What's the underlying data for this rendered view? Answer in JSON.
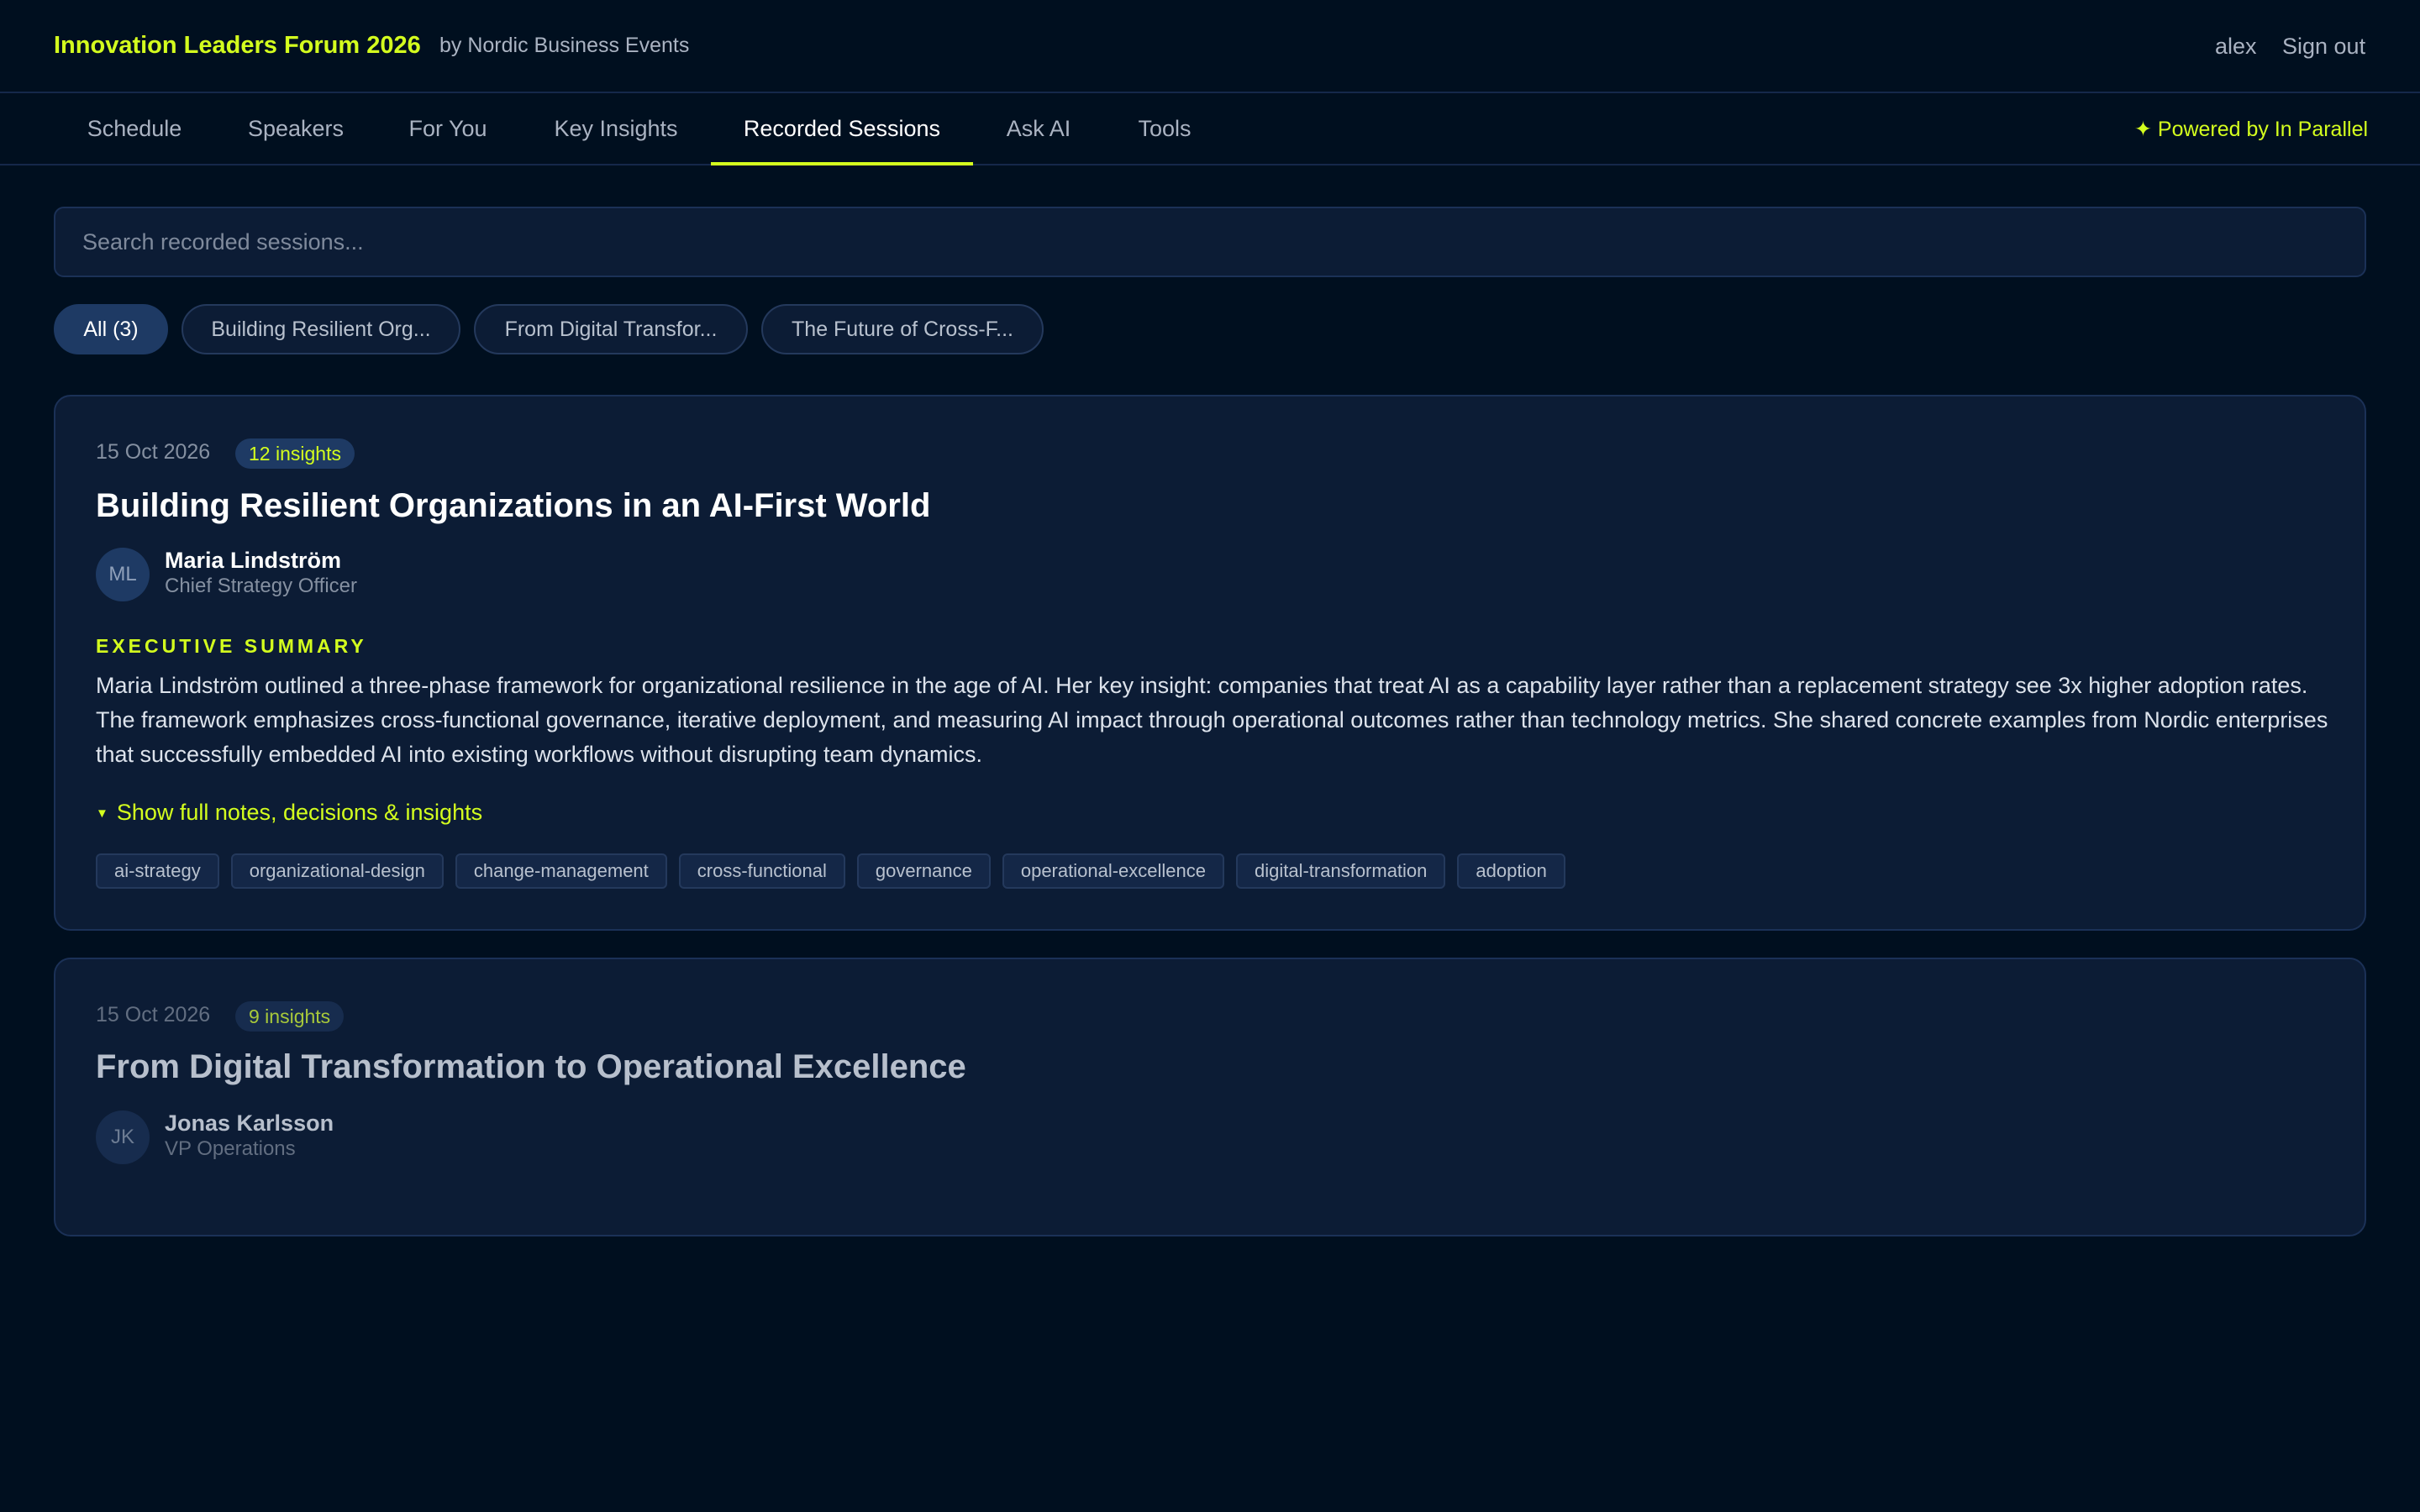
{
  "header": {
    "brand": "Innovation Leaders Forum 2026",
    "by_line": "by Nordic Business Events",
    "user": "alex",
    "sign_out": "Sign out"
  },
  "nav": {
    "tabs": [
      {
        "label": "Schedule",
        "active": false
      },
      {
        "label": "Speakers",
        "active": false
      },
      {
        "label": "For You",
        "active": false
      },
      {
        "label": "Key Insights",
        "active": false
      },
      {
        "label": "Recorded Sessions",
        "active": true
      },
      {
        "label": "Ask AI",
        "active": false
      },
      {
        "label": "Tools",
        "active": false
      }
    ],
    "powered_by": "✦ Powered by In Parallel"
  },
  "search": {
    "placeholder": "Search recorded sessions...",
    "value": ""
  },
  "filters": [
    {
      "label": "All (3)",
      "active": true
    },
    {
      "label": "Building Resilient Org...",
      "active": false
    },
    {
      "label": "From Digital Transfor...",
      "active": false
    },
    {
      "label": "The Future of Cross-F...",
      "active": false
    }
  ],
  "sessions": [
    {
      "date": "15 Oct 2026",
      "insights": "12 insights",
      "title": "Building Resilient Organizations in an AI-First World",
      "speaker": {
        "initials": "ML",
        "name": "Maria Lindström",
        "role": "Chief Strategy Officer"
      },
      "summary_label": "EXECUTIVE SUMMARY",
      "summary": "Maria Lindström outlined a three-phase framework for organizational resilience in the age of AI. Her key insight: companies that treat AI as a capability layer rather than a replacement strategy see 3x higher adoption rates. The framework emphasizes cross-functional governance, iterative deployment, and measuring AI impact through operational outcomes rather than technology metrics. She shared concrete examples from Nordic enterprises that successfully embedded AI into existing workflows without disrupting team dynamics.",
      "expand_label": "Show full notes, decisions & insights",
      "tags": [
        "ai-strategy",
        "organizational-design",
        "change-management",
        "cross-functional",
        "governance",
        "operational-excellence",
        "digital-transformation",
        "adoption"
      ]
    },
    {
      "date": "15 Oct 2026",
      "insights": "9 insights",
      "title": "From Digital Transformation to Operational Excellence",
      "speaker": {
        "initials": "JK",
        "name": "Jonas Karlsson",
        "role": "VP Operations"
      }
    }
  ],
  "colors": {
    "background": "#000f1f",
    "card": "#0c1c35",
    "accent": "#d4ff1e",
    "active_chip": "#1e3a64"
  }
}
